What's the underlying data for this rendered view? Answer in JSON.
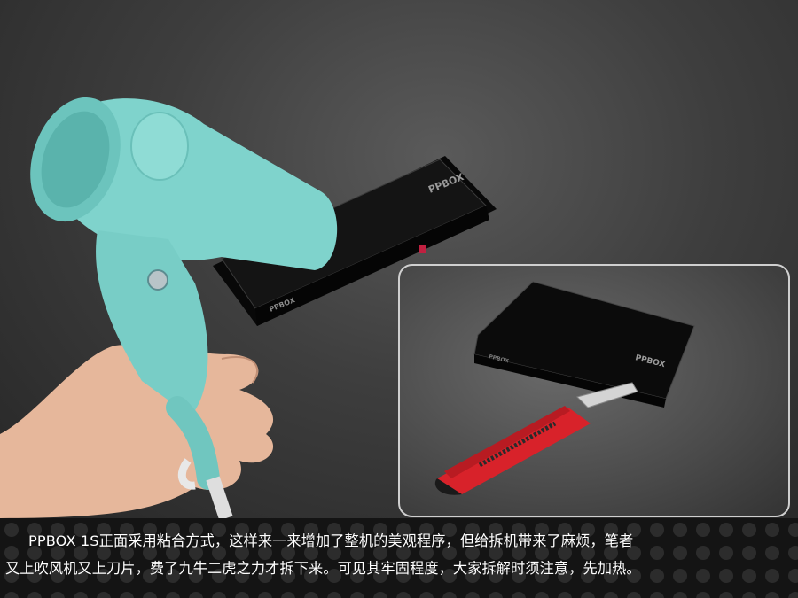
{
  "photo": {
    "subject": "PPBOX 1S set-top box being opened with a hair dryer and a utility knife",
    "device_logo": "PPBOX"
  },
  "caption": {
    "line1": "PPBOX 1S正面采用粘合方式，这样来一来增加了整机的美观程序，但给拆机带来了麻烦，笔者",
    "line2": "又上吹风机又上刀片，费了九牛二虎之力才拆下来。可见其牢固程度，大家拆解时须注意，先加热。"
  },
  "colors": {
    "background": "#3e3e3e",
    "dryer": "#7fd3cc",
    "device": "#0d0d0d",
    "knife": "#d8222a",
    "caption_text": "#ffffff"
  }
}
